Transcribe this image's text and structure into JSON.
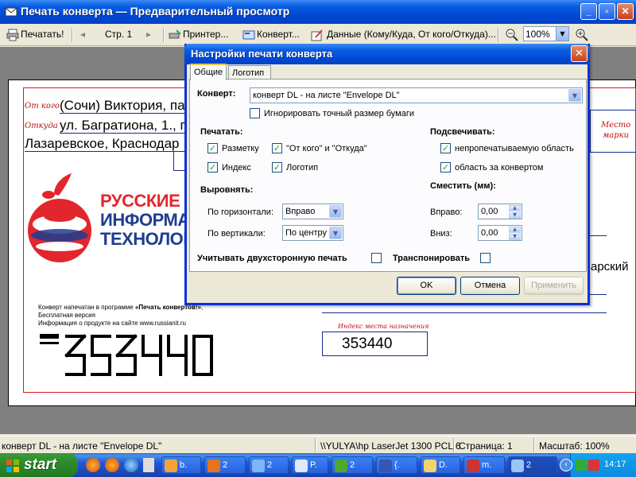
{
  "window": {
    "title": "Печать конверта — Предварительный просмотр"
  },
  "toolbar": {
    "print_label": "Печатать!",
    "page_label": "Стр. 1",
    "printer_label": "Принтер...",
    "envelope_label": "Конверт...",
    "data_label": "Данные (Кому/Куда, От кого/Откуда)...",
    "zoom_value": "100%"
  },
  "envelope": {
    "from_label": "От кого",
    "from_value": "(Сочи) Виктория, па",
    "where_label": "Откуда",
    "where_value": "ул. Багратиона, 1., п",
    "city_line": "Лазаревское, Краснодар",
    "stamp_label_1": "Место",
    "stamp_label_2": "марки",
    "logo_line1": "РУССКИЕ",
    "logo_line2": "ИНФОРМАЦ",
    "logo_line3": "ТЕХНОЛОГ",
    "note_line1_prefix": "Конверт напечатан в программе ",
    "note_line1_program": "«Печать конвертов!»",
    "note_line1_suffix": ",",
    "note_line2": "Бесплатная версия",
    "note_line3": "Информация о продукте на сайте www.russianit.ru",
    "to_region_fragment": "арский",
    "index_label": "Индекс места назначения",
    "index_value": "353440",
    "index_digits": "353440"
  },
  "dialog": {
    "title": "Настройки печати конверта",
    "tabs": [
      "Общие",
      "Логотип"
    ],
    "envelope_label": "Конверт:",
    "envelope_value": "конверт DL - на листе \"Envelope DL\"",
    "ignore_size_label": "Игнорировать точный размер бумаги",
    "ignore_size_checked": false,
    "print_header": "Печатать:",
    "print_options": [
      {
        "label": "Разметку",
        "checked": true
      },
      {
        "label": "Индекс",
        "checked": true
      },
      {
        "label": "\"От кого\" и \"Откуда\"",
        "checked": true
      },
      {
        "label": "Логотип",
        "checked": true
      }
    ],
    "highlight_header": "Подсвечивать:",
    "highlight_options": [
      {
        "label": "непропечатываемую область",
        "checked": true
      },
      {
        "label": "область за конвертом",
        "checked": true
      }
    ],
    "align_header": "Выровнять:",
    "align_h_label": "По горизонтали:",
    "align_h_value": "Вправо",
    "align_v_label": "По вертикали:",
    "align_v_value": "По центру",
    "shift_header": "Сместить (мм):",
    "shift_right_label": "Вправо:",
    "shift_right_value": "0,00",
    "shift_down_label": "Вниз:",
    "shift_down_value": "0,00",
    "duplex_label": "Учитывать двухсторонную печать",
    "duplex_checked": false,
    "transpose_label": "Транспонировать",
    "transpose_checked": false,
    "ok_label": "OK",
    "cancel_label": "Отмена",
    "apply_label": "Применить"
  },
  "statusbar": {
    "envelope": "конверт DL - на листе \"Envelope DL\"",
    "printer": "\\\\YULYA\\hp LaserJet 1300 PCL 6",
    "page": "Страница: 1",
    "scale": "Масштаб: 100%"
  },
  "taskbar": {
    "start_label": "start",
    "tasks": [
      "b.",
      "2",
      "2",
      "P.",
      "2",
      "{.",
      "D.",
      "m.",
      "2"
    ],
    "clock": "14:17"
  },
  "colors": {
    "title_blue": "#0a5fe0",
    "envelope_red": "#e01820",
    "logo_red": "#e3262d",
    "logo_blue": "#1f3c8f"
  }
}
